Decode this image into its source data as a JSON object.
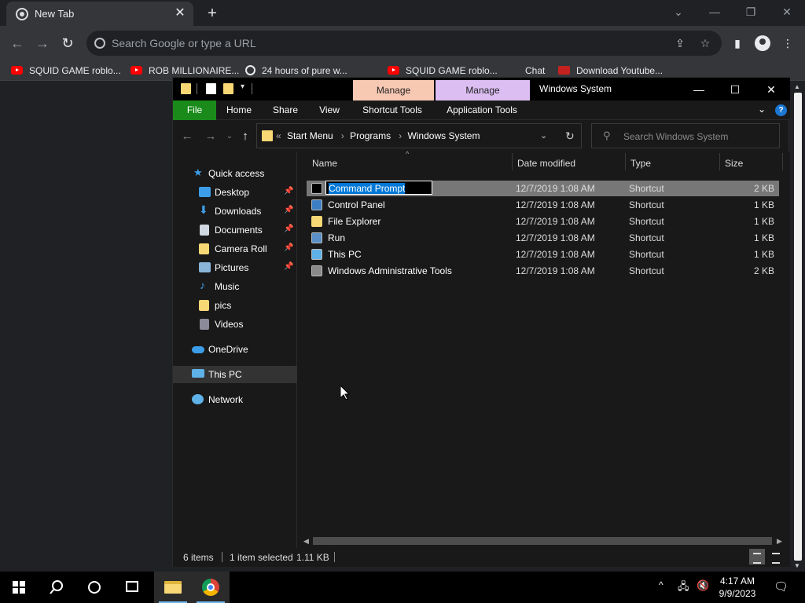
{
  "chrome": {
    "tab_title": "New Tab",
    "omnibox_placeholder": "Search Google or type a URL",
    "bookmarks": [
      {
        "label": "SQUID GAME roblo...",
        "icon": "youtube-icon"
      },
      {
        "label": "ROB MILLIONAIRE...",
        "icon": "youtube-icon"
      },
      {
        "label": "24 hours of pure w...",
        "icon": "globe-icon"
      },
      {
        "label": "SQUID GAME roblo...",
        "icon": "youtube-icon"
      },
      {
        "label": "Chat",
        "icon": "none"
      },
      {
        "label": "Download Youtube...",
        "icon": "download-icon"
      }
    ]
  },
  "explorer": {
    "window_title": "Windows System",
    "context_tabs": [
      {
        "label": "Manage",
        "group": "Shortcut Tools",
        "color": "#f7c8b2"
      },
      {
        "label": "Manage",
        "group": "Application Tools",
        "color": "#dcbef2"
      }
    ],
    "ribbon_tabs": [
      "File",
      "Home",
      "Share",
      "View",
      "Shortcut Tools",
      "Application Tools"
    ],
    "address_overflow": "«",
    "breadcrumb": [
      "Start Menu",
      "Programs",
      "Windows System"
    ],
    "search_placeholder": "Search Windows System",
    "nav": {
      "quick_access": "Quick access",
      "items": [
        {
          "label": "Desktop",
          "pinned": true,
          "icon": "desktop-icon"
        },
        {
          "label": "Downloads",
          "pinned": true,
          "icon": "download-icon"
        },
        {
          "label": "Documents",
          "pinned": true,
          "icon": "documents-icon"
        },
        {
          "label": "Camera Roll",
          "pinned": true,
          "icon": "folder-icon"
        },
        {
          "label": "Pictures",
          "pinned": true,
          "icon": "pictures-icon"
        },
        {
          "label": "Music",
          "pinned": false,
          "icon": "music-icon"
        },
        {
          "label": "pics",
          "pinned": false,
          "icon": "folder-icon"
        },
        {
          "label": "Videos",
          "pinned": false,
          "icon": "videos-icon"
        }
      ],
      "onedrive": "OneDrive",
      "this_pc": "This PC",
      "network": "Network"
    },
    "columns": [
      "Name",
      "Date modified",
      "Type",
      "Size"
    ],
    "files": [
      {
        "name": "Command Prompt",
        "date": "12/7/2019 1:08 AM",
        "type": "Shortcut",
        "size": "2 KB",
        "selected": true
      },
      {
        "name": "Control Panel",
        "date": "12/7/2019 1:08 AM",
        "type": "Shortcut",
        "size": "1 KB",
        "selected": false
      },
      {
        "name": "File Explorer",
        "date": "12/7/2019 1:08 AM",
        "type": "Shortcut",
        "size": "1 KB",
        "selected": false
      },
      {
        "name": "Run",
        "date": "12/7/2019 1:08 AM",
        "type": "Shortcut",
        "size": "1 KB",
        "selected": false
      },
      {
        "name": "This PC",
        "date": "12/7/2019 1:08 AM",
        "type": "Shortcut",
        "size": "1 KB",
        "selected": false
      },
      {
        "name": "Windows Administrative Tools",
        "date": "12/7/2019 1:08 AM",
        "type": "Shortcut",
        "size": "2 KB",
        "selected": false
      }
    ],
    "status": {
      "items": "6 items",
      "selected": "1 item selected",
      "size": "1.11 KB"
    }
  },
  "taskbar": {
    "time": "4:17 AM",
    "date": "9/9/2023"
  },
  "colors": {
    "file_tab": "#1a8b1a",
    "selection": "#0078d7",
    "folder": "#f8d775"
  }
}
